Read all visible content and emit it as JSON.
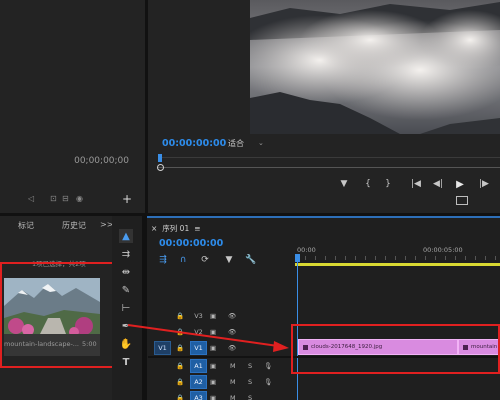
{
  "source_monitor": {
    "timecode": "00;00;00;00"
  },
  "program_monitor": {
    "timecode": "00:00:00:00",
    "fit_select": "适合",
    "buttons": [
      "add-marker-icon",
      "mark-in-icon",
      "mark-out-icon",
      "go-to-in-icon",
      "step-back-icon",
      "play-icon",
      "step-forward-icon",
      "export-frame-icon"
    ]
  },
  "left_panel": {
    "tabs": [
      "标记",
      "历史记"
    ],
    "overflow": ">>",
    "selection_info": "1项已选择，共2项",
    "media_item": {
      "name": "mountain-landscape-...",
      "duration": "5:00"
    }
  },
  "sequence": {
    "close": "×",
    "name": "序列 01",
    "menu": "≡",
    "timecode": "00:00:00:00",
    "ruler": [
      "00:00",
      "00:00:05:00"
    ],
    "tracks": [
      {
        "label": "V3",
        "lock": "🔒",
        "eye": "👁",
        "sync": "▣"
      },
      {
        "label": "V2",
        "lock": "🔒",
        "eye": "👁",
        "sync": "▣"
      },
      {
        "src": "V1",
        "label": "V1",
        "lock": "🔒",
        "eye": "👁",
        "sync": "▣"
      },
      {
        "label": "A1",
        "m": "M",
        "s": "S"
      },
      {
        "label": "A2",
        "m": "M",
        "s": "S"
      },
      {
        "label": "A3",
        "m": "M",
        "s": "S"
      }
    ],
    "clips": [
      {
        "name": "clouds-2017648_1920.jpg"
      },
      {
        "name": "mountain"
      }
    ]
  },
  "colors": {
    "accent_blue": "#2d8ceb",
    "clip_pink": "#d98be0",
    "annotation_red": "#e02020",
    "playhead_blue": "#3a8ee6",
    "workarea_yellow": "#d8d832"
  }
}
